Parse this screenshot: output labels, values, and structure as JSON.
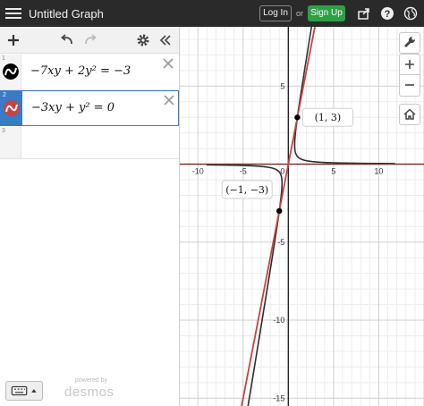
{
  "header": {
    "title": "Untitled Graph",
    "login_label": "Log In",
    "or_label": "or",
    "signup_label": "Sign Up",
    "icons": [
      "share-icon",
      "help-icon",
      "globe-icon"
    ]
  },
  "toolbar": {
    "icons": [
      "add-icon",
      "undo-icon",
      "redo-icon",
      "gear-icon",
      "collapse-icon"
    ]
  },
  "expressions": [
    {
      "number": "1",
      "latex": "−7xy + 2y² = −3",
      "color": "#000000"
    },
    {
      "number": "2",
      "latex": "−3xy + y² = 0",
      "color": "#c74440"
    },
    {
      "number": "3",
      "latex": ""
    }
  ],
  "footer": {
    "powered_label": "powered by",
    "brand": "desmos"
  },
  "graph": {
    "x_ticks": [
      "-10",
      "-5",
      "0",
      "5",
      "10"
    ],
    "y_ticks": [
      "5",
      "-5",
      "-10",
      "-15"
    ],
    "xlim": [
      -12,
      15
    ],
    "ylim": [
      -15.5,
      8.8
    ],
    "points": [
      {
        "label": "(1, 3)",
        "x": 1,
        "y": 3
      },
      {
        "label": "(−1, −3)",
        "x": -1,
        "y": -3
      }
    ],
    "curve_color": "#2d2d2d",
    "line_color": "#c74440"
  },
  "graph_controls": {
    "icons": [
      "wrench-icon",
      "plus-icon",
      "minus-icon",
      "home-icon"
    ]
  }
}
